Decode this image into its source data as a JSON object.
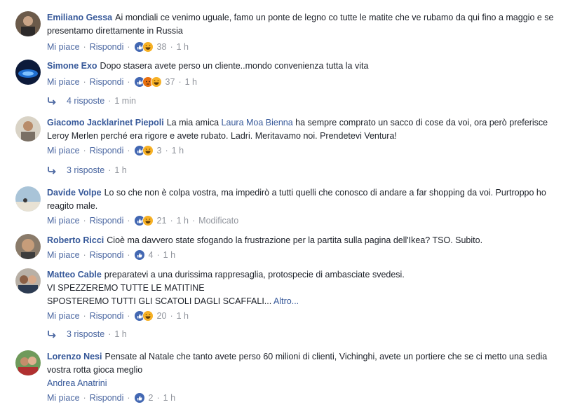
{
  "labels": {
    "like": "Mi piace",
    "reply": "Rispondi",
    "dot": "·"
  },
  "colors": {
    "link": "#365899",
    "meta": "#90949c",
    "like_blue": "#4267b2",
    "haha_yellow": "#f7b125",
    "angry": "#e9710f"
  },
  "comments": [
    {
      "author": "Emiliano Gessa",
      "text": "Ai mondiali ce venimo uguale, famo un ponte de legno co tutte le matite che ve rubamo da qui fino a maggio e se presentamo direttamente in Russia",
      "reaction_icons": [
        "like-icon",
        "haha-icon"
      ],
      "count": "38",
      "time": "1 h"
    },
    {
      "author": "Simone Exo",
      "text": "Dopo stasera avete perso un cliente..mondo convenienza tutta la vita",
      "reaction_icons": [
        "like-icon",
        "angry-icon",
        "haha-icon"
      ],
      "count": "37",
      "time": "1 h",
      "replies": {
        "label": "4 risposte",
        "time": "1 min"
      }
    },
    {
      "author": "Giacomo Jacklarinet Piepoli",
      "text_before": "La mia amica ",
      "mention": "Laura Moa Bienna",
      "text_after": " ha sempre comprato un sacco di cose da voi, ora però preferisce Leroy Merlen perché era rigore e avete rubato. Ladri. Meritavamo noi. Prendetevi Ventura!",
      "reaction_icons": [
        "like-icon",
        "haha-icon"
      ],
      "count": "3",
      "time": "1 h",
      "replies": {
        "label": "3 risposte",
        "time": "1 h"
      }
    },
    {
      "author": "Davide Volpe",
      "text": "Lo so che non è colpa vostra, ma impedirò a tutti quelli che conosco di andare a far shopping da voi. Purtroppo ho reagito male.",
      "reaction_icons": [
        "like-icon",
        "haha-icon"
      ],
      "count": "21",
      "time": "1 h",
      "edited": "Modificato"
    },
    {
      "author": "Roberto Ricci",
      "text": "Cioè ma davvero state sfogando la frustrazione per la partita sulla pagina dell'Ikea? TSO. Subito.",
      "reaction_icons": [
        "like-icon"
      ],
      "count": "4",
      "time": "1 h"
    },
    {
      "author": "Matteo Cable",
      "text_line1": "preparatevi a una durissima rappresaglia, protospecie di ambasciate svedesi.",
      "text_line2": "VI SPEZZEREMO TUTTE LE MATITINE",
      "text_line3": "SPOSTEREMO TUTTI GLI SCATOLI DAGLI SCAFFALI...",
      "more": "Altro...",
      "reaction_icons": [
        "like-icon",
        "haha-icon"
      ],
      "count": "20",
      "time": "1 h",
      "replies": {
        "label": "3 risposte",
        "time": "1 h"
      }
    },
    {
      "author": "Lorenzo Nesi",
      "text": "Pensate al Natale che tanto avete perso 60 milioni di clienti, Vichinghi, avete un portiere che se ci metto una sedia vostra rotta gioca meglio",
      "tag": "Andrea Anatrini",
      "reaction_icons": [
        "like-icon"
      ],
      "count": "2",
      "time": "1 h"
    }
  ]
}
